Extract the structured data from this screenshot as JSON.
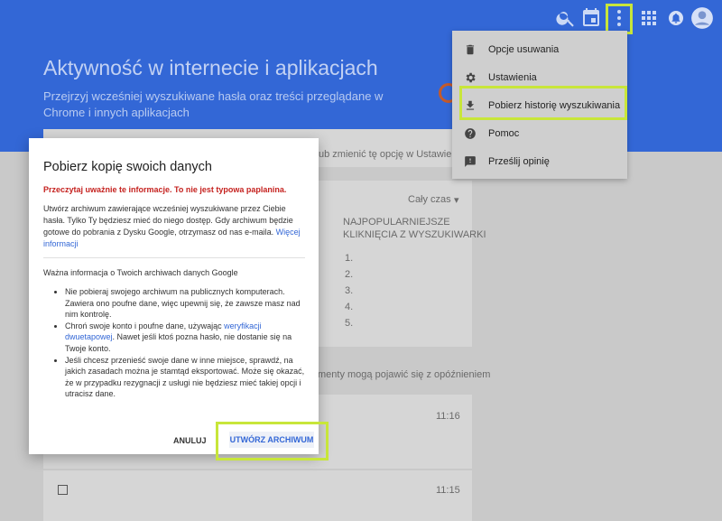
{
  "header": {
    "title": "Aktywność w internecie i aplikacjach",
    "subtitle": "Przejrzyj wcześniej wyszukiwane hasła oraz treści przeglądane w Chrome i innych aplikacjach"
  },
  "background": {
    "setting_hint": "ub zmienić tę opcję w Ustawieniach.",
    "filter": "Cały czas",
    "col_heading_1": "NAJPOPULARNIEJSZE",
    "col_heading_2": "KLIKNIĘCIA Z WYSZUKIWARKI",
    "list_numbers": [
      "1.",
      "2.",
      "3.",
      "4.",
      "5."
    ],
    "delay_note": "menty mogą pojawić się z opóźnieniem",
    "time_1": "11:16",
    "time_2": "11:15"
  },
  "menu": {
    "items": [
      {
        "label": "Opcje usuwania",
        "icon": "trash-icon"
      },
      {
        "label": "Ustawienia",
        "icon": "gear-icon"
      },
      {
        "label": "Pobierz historię wyszukiwania",
        "icon": "download-icon"
      },
      {
        "label": "Pomoc",
        "icon": "help-icon"
      },
      {
        "label": "Prześlij opinię",
        "icon": "feedback-icon"
      }
    ]
  },
  "dialog": {
    "title": "Pobierz kopię swoich danych",
    "warning": "Przeczytaj uważnie te informacje. To nie jest typowa paplanina.",
    "paragraph": "Utwórz archiwum zawierające wcześniej wyszukiwane przez Ciebie hasła. Tylko Ty będziesz mieć do niego dostęp. Gdy archiwum będzie gotowe do pobrania z Dysku Google, otrzymasz od nas e-maila. ",
    "more_link": "Więcej informacji",
    "important_heading": "Ważna informacja o Twoich archiwach danych Google",
    "bullet_1": "Nie pobieraj swojego archiwum na publicznych komputerach. Zawiera ono poufne dane, więc upewnij się, że zawsze masz nad nim kontrolę.",
    "bullet_2_pre": "Chroń swoje konto i poufne dane, używając ",
    "bullet_2_link": "weryfikacji dwuetapowej",
    "bullet_2_post": ". Nawet jeśli ktoś pozna hasło, nie dostanie się na Twoje konto.",
    "bullet_3": "Jeśli chcesz przenieść swoje dane w inne miejsce, sprawdź, na jakich zasadach można je stamtąd eksportować. Może się okazać, że w przypadku rezygnacji z usługi nie będziesz mieć takiej opcji i utracisz dane.",
    "cancel_label": "ANULUJ",
    "create_label": "UTWÓRZ ARCHIWUM"
  },
  "colors": {
    "header": "#3367d6",
    "highlight": "#c8e63a",
    "warning": "#c5221f"
  }
}
